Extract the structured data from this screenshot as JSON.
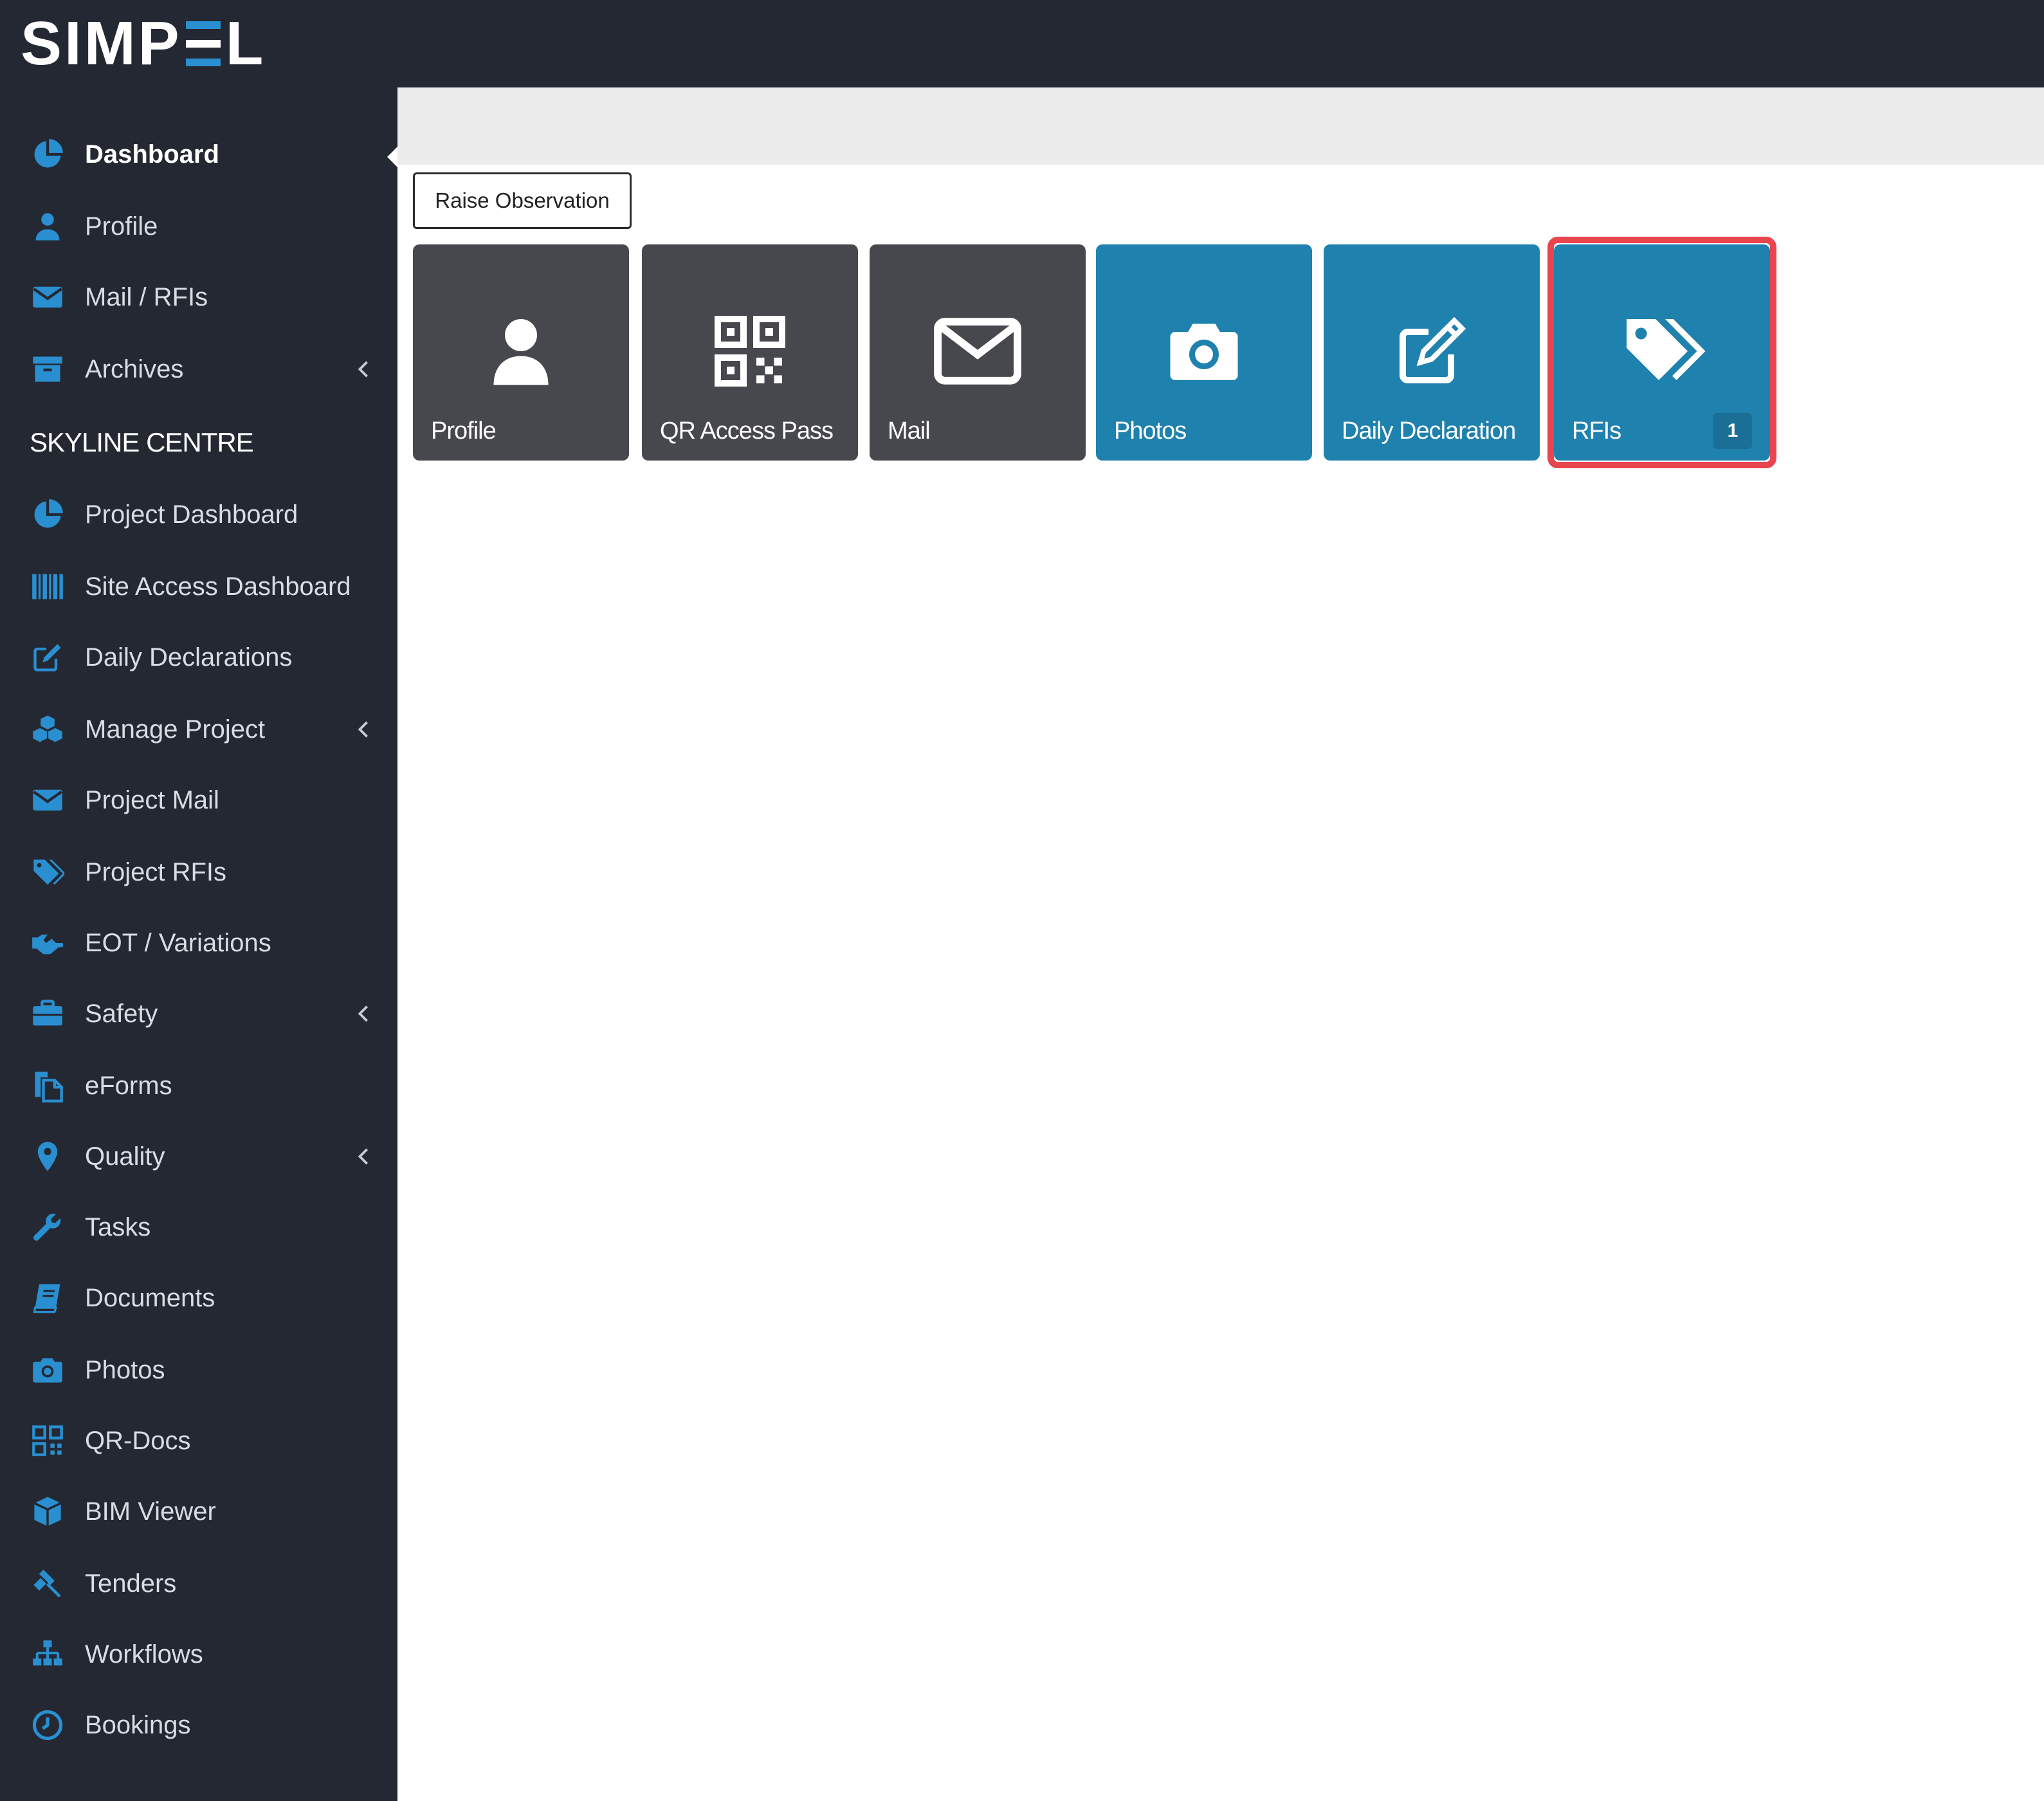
{
  "logo": {
    "left": "SIMP",
    "right": "L"
  },
  "colors": {
    "accent": "#2a8fd0",
    "sidebar_bg": "#242833",
    "tile_dark": "#46484d",
    "tile_blue": "#1f81ad",
    "highlight": "#e8454e"
  },
  "sidebar": {
    "top_items": [
      {
        "label": "Dashboard",
        "icon": "pie-chart-icon"
      },
      {
        "label": "Profile",
        "icon": "user-icon"
      },
      {
        "label": "Mail / RFIs",
        "icon": "envelope-icon"
      },
      {
        "label": "Archives",
        "icon": "archive-icon"
      }
    ],
    "section_title": "SKYLINE CENTRE",
    "project_items": [
      {
        "label": "Project Dashboard",
        "icon": "pie-chart-icon"
      },
      {
        "label": "Site Access Dashboard",
        "icon": "barcode-icon"
      },
      {
        "label": "Daily Declarations",
        "icon": "edit-icon"
      },
      {
        "label": "Manage Project",
        "icon": "cubes-icon"
      },
      {
        "label": "Project Mail",
        "icon": "envelope-icon"
      },
      {
        "label": "Project RFIs",
        "icon": "tags-icon"
      },
      {
        "label": "EOT / Variations",
        "icon": "handshake-icon"
      },
      {
        "label": "Safety",
        "icon": "briefcase-icon"
      },
      {
        "label": "eForms",
        "icon": "files-icon"
      },
      {
        "label": "Quality",
        "icon": "map-marker-icon"
      },
      {
        "label": "Tasks",
        "icon": "wrench-icon"
      },
      {
        "label": "Documents",
        "icon": "book-icon"
      },
      {
        "label": "Photos",
        "icon": "camera-icon"
      },
      {
        "label": "QR-Docs",
        "icon": "qrcode-icon"
      },
      {
        "label": "BIM Viewer",
        "icon": "cube-icon"
      },
      {
        "label": "Tenders",
        "icon": "gavel-icon"
      },
      {
        "label": "Workflows",
        "icon": "sitemap-icon"
      },
      {
        "label": "Bookings",
        "icon": "clock-icon"
      }
    ]
  },
  "main": {
    "raise_button": "Raise Observation",
    "tiles": [
      {
        "label": "Profile",
        "icon": "user-icon"
      },
      {
        "label": "QR Access Pass",
        "icon": "qrcode-icon"
      },
      {
        "label": "Mail",
        "icon": "envelope-icon"
      },
      {
        "label": "Photos",
        "icon": "camera-icon"
      },
      {
        "label": "Daily Declaration",
        "icon": "edit-icon"
      },
      {
        "label": "RFIs",
        "icon": "tags-icon",
        "badge": "1"
      }
    ]
  }
}
